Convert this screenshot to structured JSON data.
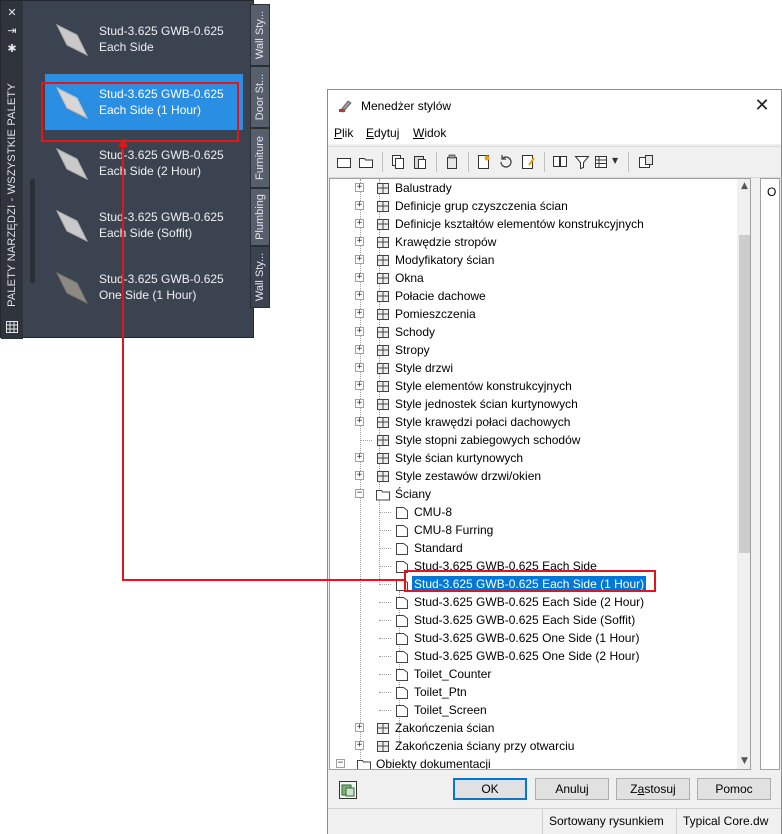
{
  "palette": {
    "title": "PALETY NARZĘDZI - WSZYSTKIE PALETY",
    "items": [
      {
        "line1": "Stud-3.625 GWB-0.625",
        "line2": "Each Side",
        "selected": false
      },
      {
        "line1": "Stud-3.625 GWB-0.625",
        "line2": "Each Side (1 Hour)",
        "selected": true
      },
      {
        "line1": "Stud-3.625 GWB-0.625",
        "line2": "Each Side (2 Hour)",
        "selected": false
      },
      {
        "line1": "Stud-3.625 GWB-0.625",
        "line2": "Each Side (Soffit)",
        "selected": false
      },
      {
        "line1": "Stud-3.625 GWB-0.625",
        "line2": "One Side (1 Hour)",
        "selected": false
      }
    ],
    "tabs": [
      "Wall Sty...",
      "Door St...",
      "Furniture",
      "Plumbing",
      "Wall Sty..."
    ],
    "accent": "#2a8ee3"
  },
  "window": {
    "title": "Menedżer stylów",
    "menu": [
      {
        "accel": "P",
        "rest": "lik"
      },
      {
        "accel": "E",
        "rest": "dytuj"
      },
      {
        "accel": "W",
        "rest": "idok"
      }
    ],
    "right_pane_text": "O",
    "tree": [
      {
        "label": "Balustrady",
        "level": 1,
        "expander": "+",
        "icon": "railing-icon"
      },
      {
        "label": "Definicje grup czyszczenia ścian",
        "level": 1,
        "expander": "+",
        "icon": "cleanup-group-icon"
      },
      {
        "label": "Definicje kształtów elementów konstrukcyjnych",
        "level": 1,
        "expander": "+",
        "icon": "member-shape-icon"
      },
      {
        "label": "Krawędzie stropów",
        "level": 1,
        "expander": "+",
        "icon": "slab-edge-icon"
      },
      {
        "label": "Modyfikatory ścian",
        "level": 1,
        "expander": "+",
        "icon": "wall-modifier-icon"
      },
      {
        "label": "Okna",
        "level": 1,
        "expander": "+",
        "icon": "window-icon"
      },
      {
        "label": "Połacie dachowe",
        "level": 1,
        "expander": "+",
        "icon": "roof-slab-icon"
      },
      {
        "label": "Pomieszczenia",
        "level": 1,
        "expander": "+",
        "icon": "space-icon"
      },
      {
        "label": "Schody",
        "level": 1,
        "expander": "+",
        "icon": "stair-icon"
      },
      {
        "label": "Stropy",
        "level": 1,
        "expander": "+",
        "icon": "slab-icon"
      },
      {
        "label": "Style drzwi",
        "level": 1,
        "expander": "+",
        "icon": "door-icon"
      },
      {
        "label": "Style elementów konstrukcyjnych",
        "level": 1,
        "expander": "+",
        "icon": "member-icon"
      },
      {
        "label": "Style jednostek ścian kurtynowych",
        "level": 1,
        "expander": "+",
        "icon": "curtain-unit-icon"
      },
      {
        "label": "Style krawędzi połaci dachowych",
        "level": 1,
        "expander": "+",
        "icon": "roof-edge-icon"
      },
      {
        "label": "Style stopni zabiegowych schodów",
        "level": 1,
        "expander": "",
        "icon": "winder-icon"
      },
      {
        "label": "Style ścian kurtynowych",
        "level": 1,
        "expander": "+",
        "icon": "curtain-wall-icon"
      },
      {
        "label": "Style zestawów drzwi/okien",
        "level": 1,
        "expander": "+",
        "icon": "door-window-assembly-icon"
      },
      {
        "label": "Ściany",
        "level": 1,
        "expander": "-",
        "icon": "wall-folder-icon"
      },
      {
        "label": "CMU-8",
        "level": 2,
        "expander": "",
        "icon": "wall-style-icon"
      },
      {
        "label": "CMU-8 Furring",
        "level": 2,
        "expander": "",
        "icon": "wall-style-icon"
      },
      {
        "label": "Standard",
        "level": 2,
        "expander": "",
        "icon": "wall-style-icon"
      },
      {
        "label": "Stud-3.625 GWB-0.625 Each Side",
        "level": 2,
        "expander": "",
        "icon": "wall-style-icon"
      },
      {
        "label": "Stud-3.625 GWB-0.625 Each Side (1 Hour)",
        "level": 2,
        "expander": "",
        "icon": "wall-style-icon",
        "selected": true
      },
      {
        "label": "Stud-3.625 GWB-0.625 Each Side (2 Hour)",
        "level": 2,
        "expander": "",
        "icon": "wall-style-icon"
      },
      {
        "label": "Stud-3.625 GWB-0.625 Each Side (Soffit)",
        "level": 2,
        "expander": "",
        "icon": "wall-style-icon"
      },
      {
        "label": "Stud-3.625 GWB-0.625 One Side (1 Hour)",
        "level": 2,
        "expander": "",
        "icon": "wall-style-icon"
      },
      {
        "label": "Stud-3.625 GWB-0.625 One Side (2 Hour)",
        "level": 2,
        "expander": "",
        "icon": "wall-style-icon"
      },
      {
        "label": "Toilet_Counter",
        "level": 2,
        "expander": "",
        "icon": "wall-style-icon"
      },
      {
        "label": "Toilet_Ptn",
        "level": 2,
        "expander": "",
        "icon": "wall-style-icon"
      },
      {
        "label": "Toilet_Screen",
        "level": 2,
        "expander": "",
        "icon": "wall-style-icon"
      },
      {
        "label": "Zakończenia ścian",
        "level": 1,
        "expander": "+",
        "icon": "wall-endcap-icon"
      },
      {
        "label": "Zakończenia ściany przy otwarciu",
        "level": 1,
        "expander": "+",
        "icon": "opening-endcap-icon"
      },
      {
        "label": "Obiekty dokumentacji",
        "level": 0,
        "expander": "-",
        "icon": "folder-icon"
      }
    ],
    "buttons": {
      "ok": "OK",
      "cancel": "Anuluj",
      "apply_pre": "Z",
      "apply_accel": "a",
      "apply_post": "stosuj",
      "help": "Pomoc"
    },
    "status": {
      "sort": "Sortowany rysunkiem",
      "drawing": "Typical Core.dw"
    },
    "selection_color": "#0078d7"
  },
  "callout_color": "#e0161a"
}
